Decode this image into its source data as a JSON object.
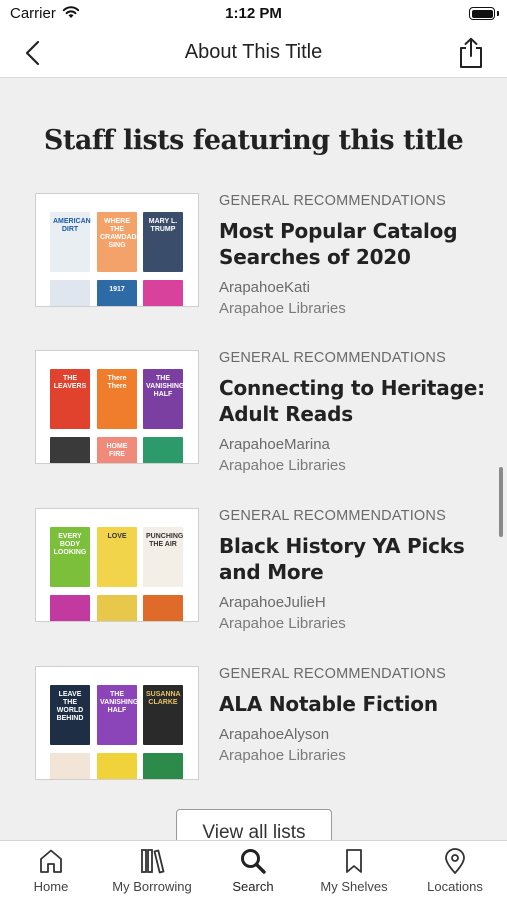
{
  "status_bar": {
    "carrier": "Carrier",
    "time": "1:12 PM"
  },
  "nav": {
    "title": "About This Title",
    "back_icon": "chevron-left-icon",
    "share_icon": "share-icon"
  },
  "section": {
    "title": "Staff lists featuring this title"
  },
  "lists": [
    {
      "category": "GENERAL RECOMMENDATIONS",
      "title": "Most Popular Catalog Searches of 2020",
      "author": "ArapahoeKati",
      "library": "Arapahoe Libraries"
    },
    {
      "category": "GENERAL RECOMMENDATIONS",
      "title": "Connecting to Heritage: Adult Reads",
      "author": "ArapahoeMarina",
      "library": "Arapahoe Libraries"
    },
    {
      "category": "GENERAL RECOMMENDATIONS",
      "title": "Black History YA Picks and More",
      "author": "ArapahoeJulieH",
      "library": "Arapahoe Libraries"
    },
    {
      "category": "GENERAL RECOMMENDATIONS",
      "title": "ALA Notable Fiction",
      "author": "ArapahoeAlyson",
      "library": "Arapahoe Libraries"
    }
  ],
  "view_all_label": "View all lists",
  "tabs": [
    {
      "label": "Home",
      "icon": "home-icon"
    },
    {
      "label": "My Borrowing",
      "icon": "books-icon"
    },
    {
      "label": "Search",
      "icon": "search-icon"
    },
    {
      "label": "My Shelves",
      "icon": "bookmark-icon"
    },
    {
      "label": "Locations",
      "icon": "location-pin-icon"
    }
  ],
  "colors": {
    "background": "#efefef",
    "surface": "#ffffff",
    "text": "#222222",
    "secondary_text": "#6a6a6a"
  }
}
